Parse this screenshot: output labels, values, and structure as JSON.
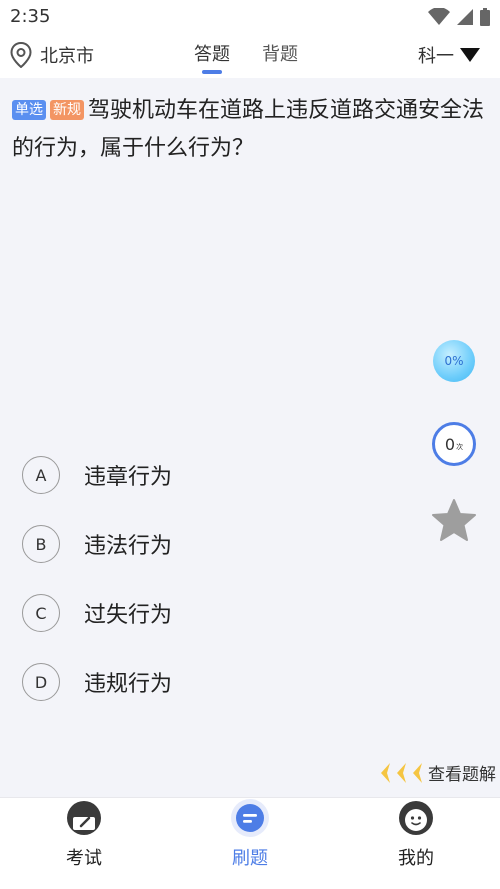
{
  "status_bar": {
    "time": "2:35"
  },
  "header": {
    "location": "北京市",
    "tabs": [
      {
        "label": "答题",
        "active": true
      },
      {
        "label": "背题",
        "active": false
      }
    ],
    "subject": "科一"
  },
  "question": {
    "type_badge": "单选",
    "new_badge": "新规",
    "text": "驾驶机动车在道路上违反道路交通安全法的行为，属于什么行为？"
  },
  "side_panel": {
    "accuracy": "0%",
    "count": "0",
    "count_unit": "次"
  },
  "options": [
    {
      "letter": "A",
      "text": "违章行为"
    },
    {
      "letter": "B",
      "text": "违法行为"
    },
    {
      "letter": "C",
      "text": "过失行为"
    },
    {
      "letter": "D",
      "text": "违规行为"
    }
  ],
  "explain_link": "查看题解",
  "bottom_nav": [
    {
      "label": "考试",
      "icon": "exam-icon",
      "active": false
    },
    {
      "label": "刷题",
      "icon": "practice-icon",
      "active": true
    },
    {
      "label": "我的",
      "icon": "profile-icon",
      "active": false
    }
  ],
  "colors": {
    "accent": "#4d7de6",
    "type_badge": "#5a8ff0",
    "new_badge": "#f39563",
    "chevron": "#f5c542",
    "star": "#9e9e9e",
    "background": "#f3f4f9"
  }
}
